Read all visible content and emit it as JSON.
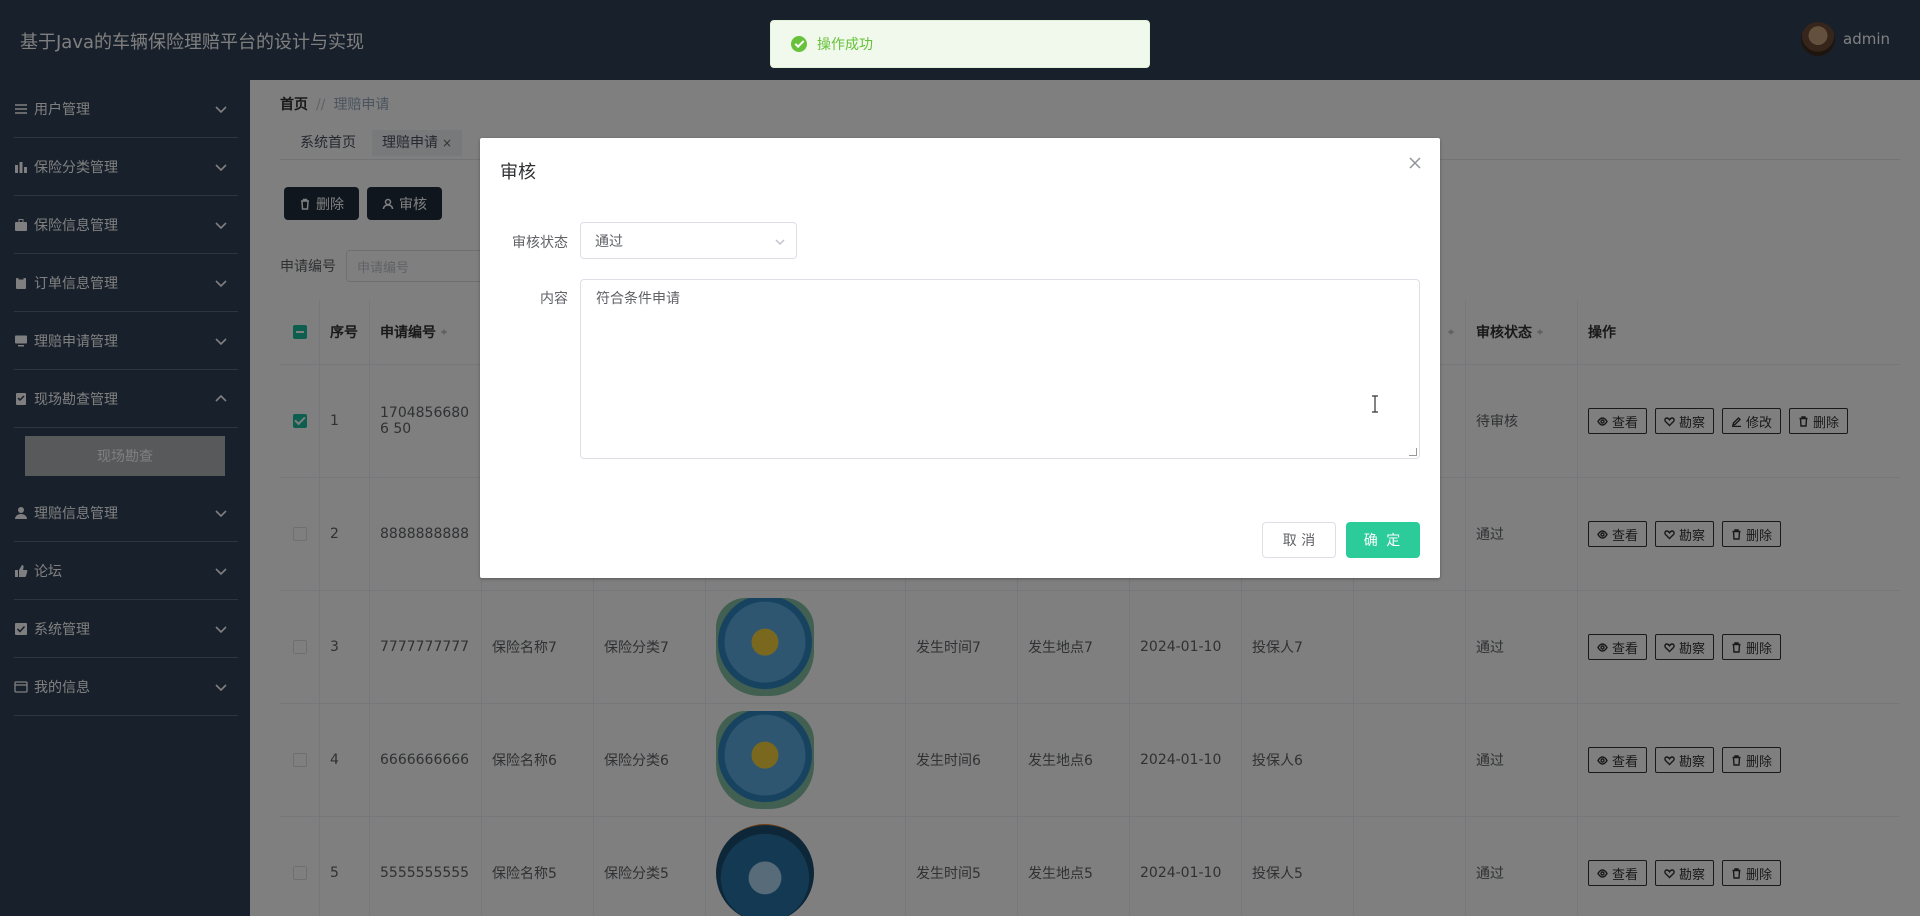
{
  "header": {
    "title": "基于Java的车辆保险理赔平台的设计与实现",
    "username": "admin"
  },
  "sidebar": {
    "items": [
      {
        "label": "用户管理",
        "icon": "list-icon",
        "expanded": false
      },
      {
        "label": "保险分类管理",
        "icon": "chart-icon",
        "expanded": false
      },
      {
        "label": "保险信息管理",
        "icon": "briefcase-icon",
        "expanded": false
      },
      {
        "label": "订单信息管理",
        "icon": "clipboard-icon",
        "expanded": false
      },
      {
        "label": "理赔申请管理",
        "icon": "monitor-icon",
        "expanded": false
      },
      {
        "label": "现场勘查管理",
        "icon": "checklist-icon",
        "expanded": true
      },
      {
        "label": "理赔信息管理",
        "icon": "user-icon",
        "expanded": false
      },
      {
        "label": "论坛",
        "icon": "thumbs-up-icon",
        "expanded": false
      },
      {
        "label": "系统管理",
        "icon": "check-square-icon",
        "expanded": false
      },
      {
        "label": "我的信息",
        "icon": "card-icon",
        "expanded": false
      }
    ],
    "subitem": "现场勘查"
  },
  "breadcrumb": {
    "home": "首页",
    "separator": "//",
    "current": "理赔申请"
  },
  "tabs": [
    {
      "label": "系统首页"
    },
    {
      "label": "理赔申请",
      "closable": "×"
    }
  ],
  "toolbar": {
    "delete_label": "删除",
    "audit_label": "审核"
  },
  "search": {
    "label": "申请编号",
    "placeholder": "申请编号"
  },
  "table": {
    "headers": {
      "index": "序号",
      "code": "申请编号",
      "status": "审核状态",
      "ops": "操作"
    },
    "rows": [
      {
        "index": "1",
        "code": "17048566806 50",
        "name": "",
        "category": "",
        "image": "",
        "time": "",
        "place": "",
        "date": "",
        "holder": "",
        "status": "待审核",
        "checked": true,
        "ops": [
          "查看",
          "勘察",
          "修改",
          "删除"
        ]
      },
      {
        "index": "2",
        "code": "8888888888",
        "name": "",
        "category": "",
        "image": "",
        "time": "",
        "place": "",
        "date": "",
        "holder": "",
        "status": "通过",
        "checked": false,
        "ops": [
          "查看",
          "勘察",
          "删除"
        ]
      },
      {
        "index": "3",
        "code": "7777777777",
        "name": "保险名称7",
        "category": "保险分类7",
        "image": "car",
        "time": "发生时间7",
        "place": "发生地点7",
        "date": "2024-01-10",
        "holder": "投保人7",
        "status": "通过",
        "checked": false,
        "ops": [
          "查看",
          "勘察",
          "删除"
        ]
      },
      {
        "index": "4",
        "code": "6666666666",
        "name": "保险名称6",
        "category": "保险分类6",
        "image": "car",
        "time": "发生时间6",
        "place": "发生地点6",
        "date": "2024-01-10",
        "holder": "投保人6",
        "status": "通过",
        "checked": false,
        "ops": [
          "查看",
          "勘察",
          "删除"
        ]
      },
      {
        "index": "5",
        "code": "5555555555",
        "name": "保险名称5",
        "category": "保险分类5",
        "image": "pro",
        "time": "发生时间5",
        "place": "发生地点5",
        "date": "2024-01-10",
        "holder": "投保人5",
        "status": "通过",
        "checked": false,
        "ops": [
          "查看",
          "勘察",
          "删除"
        ]
      }
    ]
  },
  "dialog": {
    "title": "审核",
    "status_label": "审核状态",
    "status_value": "通过",
    "content_label": "内容",
    "content_value": "符合条件申请",
    "cancel_label": "取 消",
    "confirm_label": "确 定"
  },
  "toast": {
    "message": "操作成功"
  },
  "colors": {
    "sidebar_bg": "#304156",
    "accent": "#2bcb9a",
    "dark_btn": "#1f2d3d",
    "toast_bg": "#f0f9eb",
    "toast_text": "#67c23a"
  }
}
